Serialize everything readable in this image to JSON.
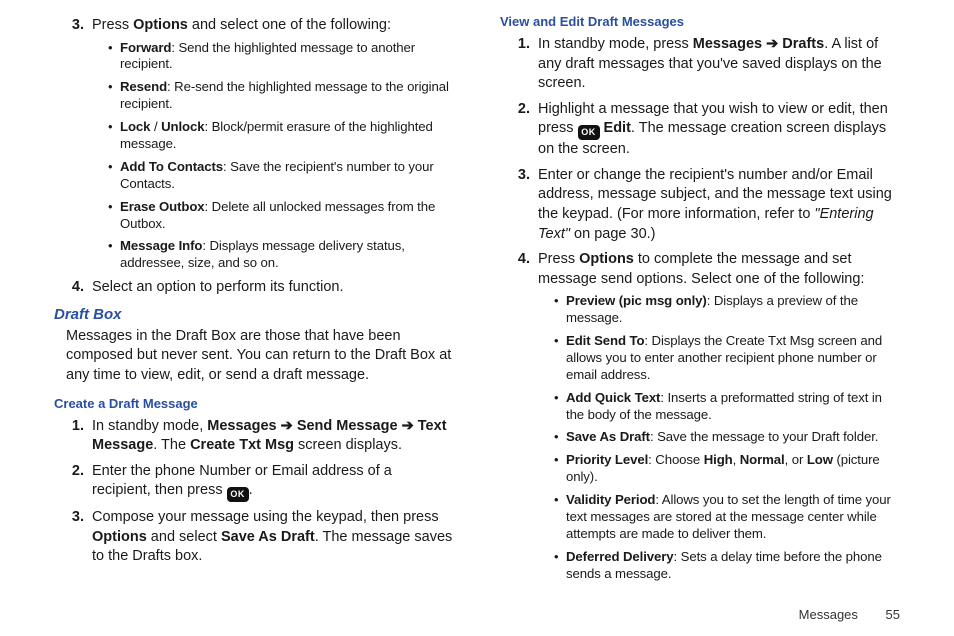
{
  "left": {
    "ol1": {
      "step3_intro": [
        "Press ",
        " and select one of the following:"
      ],
      "step3_options_bold": "Options",
      "forward": {
        "label": "Forward",
        "desc": ": Send the highlighted message to another recipient."
      },
      "resend": {
        "label": "Resend",
        "desc": ": Re-send the highlighted message to the original recipient."
      },
      "lock": {
        "label1": "Lock",
        "sep": " / ",
        "label2": "Unlock",
        "desc": ": Block/permit erasure of the highlighted message."
      },
      "addto": {
        "label": "Add To Contacts",
        "desc": ": Save the recipient's number to your Contacts."
      },
      "erase": {
        "label": "Erase Outbox",
        "desc": ": Delete all unlocked messages from the Outbox."
      },
      "msginfo": {
        "label": "Message Info",
        "desc": ": Displays message delivery status, addressee, size, and so on."
      },
      "step4": "Select an option to perform its function."
    },
    "draftbox_h": "Draft Box",
    "draftbox_p": "Messages in the Draft Box are those that have been composed but never sent. You can return to the Draft Box at any time to view, edit, or send a draft message.",
    "create_h": "Create a Draft Message",
    "ol2": {
      "s1": {
        "pre": "In standby mode, ",
        "b1": "Messages",
        "a1": " ➔ ",
        "b2": "Send Message",
        "a2": " ➔ ",
        "b3": "Text Message",
        "mid": ". The ",
        "b4": "Create Txt Msg",
        "post": " screen displays."
      },
      "s2_pre": "Enter the phone Number or Email address of a recipient, then press ",
      "s2_post": ".",
      "s3_pre": "Compose your message using the keypad, then press ",
      "s3_b1": "Options",
      "s3_mid": " and select ",
      "s3_b2": "Save As Draft",
      "s3_post": ". The message saves to the Drafts box."
    }
  },
  "right": {
    "view_h": "View and Edit Draft Messages",
    "ol": {
      "s1_pre": "In standby mode, press ",
      "s1_b1": "Messages",
      "s1_arrow": "  ➔  ",
      "s1_b2": "Drafts",
      "s1_post": ". A list of any draft messages that you've saved displays on the screen.",
      "s2_pre": "Highlight a message that you wish to view or edit, then press ",
      "s2_b": " Edit",
      "s2_post": ". The message creation screen displays on the screen.",
      "s3_pre": "Enter or change the recipient's number and/or Email address, message subject, and the message text using the keypad. (For more information, refer to ",
      "s3_it": "\"Entering Text\"",
      "s3_post": "  on page 30.)",
      "s4_pre": "Press ",
      "s4_b": "Options",
      "s4_post": " to complete the message and set message send options. Select one of the following:"
    },
    "bul": {
      "preview": {
        "label": "Preview (pic msg only)",
        "desc": ": Displays a preview of the message."
      },
      "editsend": {
        "label": "Edit Send To",
        "desc": ": Displays the Create Txt Msg screen and allows you to enter another recipient phone number or email address."
      },
      "addqt": {
        "label": "Add Quick Text",
        "desc": ": Inserts a preformatted string of text in the body of the message."
      },
      "savedraft": {
        "label": "Save As Draft",
        "desc": ": Save the message to your Draft folder."
      },
      "priority": {
        "label": "Priority Level",
        "pre": ": Choose ",
        "h": "High",
        "c1": ", ",
        "n": "Normal",
        "c2": ", or ",
        "l": "Low",
        "post": " (picture only)."
      },
      "validity": {
        "label": "Validity Period",
        "desc": ": Allows you to set the length of time your text messages are stored at the message center while attempts are made to deliver them."
      },
      "deferred": {
        "label": "Deferred Delivery",
        "desc": ": Sets a delay time before the phone sends a message."
      }
    }
  },
  "ok_label": "OK",
  "footer_section": "Messages",
  "footer_page": "55"
}
